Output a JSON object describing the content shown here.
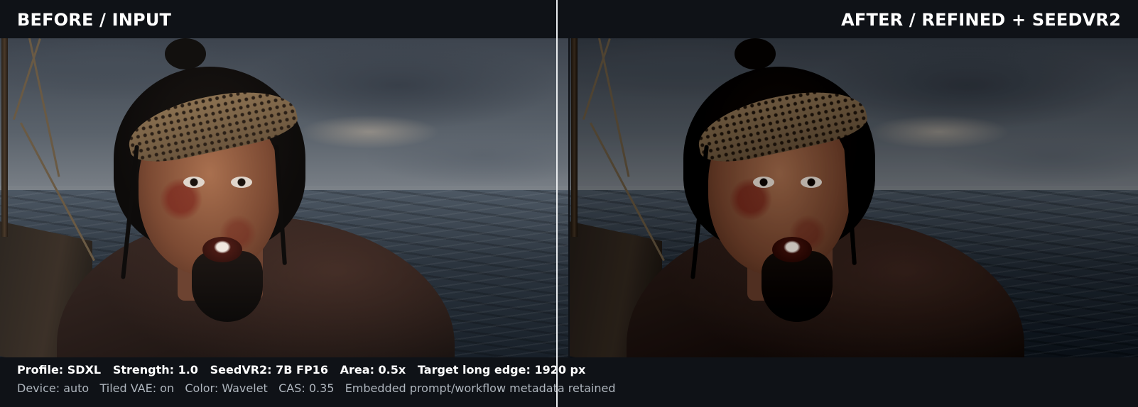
{
  "header": {
    "left_label": "BEFORE / INPUT",
    "right_label": "AFTER / REFINED + SEEDVR2"
  },
  "footer": {
    "line1": "Profile: SDXL   Strength: 1.0   SeedVR2: 7B FP16   Area: 0.5x   Target long edge: 1920 px",
    "line2": "Device: auto   Tiled VAE: on   Color: Wavelet   CAS: 0.35   Embedded prompt/workflow metadata retained"
  }
}
